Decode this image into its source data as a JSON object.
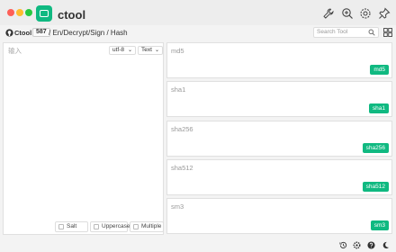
{
  "app": {
    "title": "ctool"
  },
  "titlebar": {
    "icons": [
      "wrench-icon",
      "zoom-in-icon",
      "settings-icon",
      "pin-icon"
    ]
  },
  "pathbar": {
    "brand": "Ctool",
    "count": "587",
    "breadcrumb": "/ En/Decrypt/Sign / Hash",
    "search_placeholder": "Search Tool"
  },
  "input": {
    "placeholder": "输入",
    "encoding": "utf-8",
    "format": "Text",
    "options": {
      "salt": "Salt",
      "uppercase": "Uppercase",
      "multiple": "Multiple"
    }
  },
  "results": [
    {
      "label": "md5",
      "button": "md5"
    },
    {
      "label": "sha1",
      "button": "sha1"
    },
    {
      "label": "sha256",
      "button": "sha256"
    },
    {
      "label": "sha512",
      "button": "sha512"
    },
    {
      "label": "sm3",
      "button": "sm3"
    }
  ],
  "bottom_icons": [
    "history-icon",
    "settings-icon",
    "help-icon",
    "theme-icon"
  ],
  "colors": {
    "accent": "#10b981",
    "close": "#fe5f57",
    "minimize": "#febc2e",
    "maximize": "#28c840"
  }
}
